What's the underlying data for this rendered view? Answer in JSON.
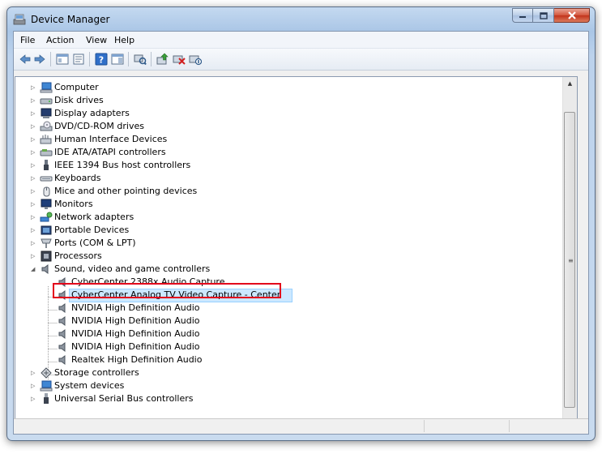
{
  "window": {
    "title": "Device Manager"
  },
  "menu": [
    "File",
    "Action",
    "View",
    "Help"
  ],
  "toolbar": {
    "icons": [
      "back-icon",
      "forward-icon",
      "show-hide-console-tree-icon",
      "properties-icon",
      "help-icon",
      "action-pane-icon",
      "scan-hardware-icon",
      "update-driver-icon",
      "uninstall-icon",
      "disable-icon"
    ]
  },
  "tree": {
    "top_level": [
      {
        "label": "Computer",
        "icon": "computer-icon"
      },
      {
        "label": "Disk drives",
        "icon": "disk-drive-icon"
      },
      {
        "label": "Display adapters",
        "icon": "display-adapter-icon"
      },
      {
        "label": "DVD/CD-ROM drives",
        "icon": "dvd-drive-icon"
      },
      {
        "label": "Human Interface Devices",
        "icon": "hid-icon"
      },
      {
        "label": "IDE ATA/ATAPI controllers",
        "icon": "ide-controller-icon"
      },
      {
        "label": "IEEE 1394 Bus host controllers",
        "icon": "ieee1394-icon"
      },
      {
        "label": "Keyboards",
        "icon": "keyboard-icon"
      },
      {
        "label": "Mice and other pointing devices",
        "icon": "mouse-icon"
      },
      {
        "label": "Monitors",
        "icon": "monitor-icon"
      },
      {
        "label": "Network adapters",
        "icon": "network-adapter-icon"
      },
      {
        "label": "Portable Devices",
        "icon": "portable-device-icon"
      },
      {
        "label": "Ports (COM & LPT)",
        "icon": "port-icon"
      },
      {
        "label": "Processors",
        "icon": "processor-icon"
      },
      {
        "label": "Sound, video and game controllers",
        "icon": "speaker-icon"
      }
    ],
    "sound_children": [
      "CyberCenter  2388x Audio Capture",
      "CyberCenter Analog TV Video Capture - Center",
      "NVIDIA High Definition Audio",
      "NVIDIA High Definition Audio",
      "NVIDIA High Definition Audio",
      "NVIDIA High Definition Audio",
      "Realtek High Definition Audio"
    ],
    "bottom_level": [
      {
        "label": "Storage controllers",
        "icon": "storage-controller-icon"
      },
      {
        "label": "System devices",
        "icon": "system-device-icon"
      },
      {
        "label": "Universal Serial Bus controllers",
        "icon": "usb-icon"
      }
    ],
    "selected": "CyberCenter Analog TV Video Capture - Center"
  },
  "colors": {
    "highlight": "#e3001b",
    "selection": "#cce8ff"
  }
}
